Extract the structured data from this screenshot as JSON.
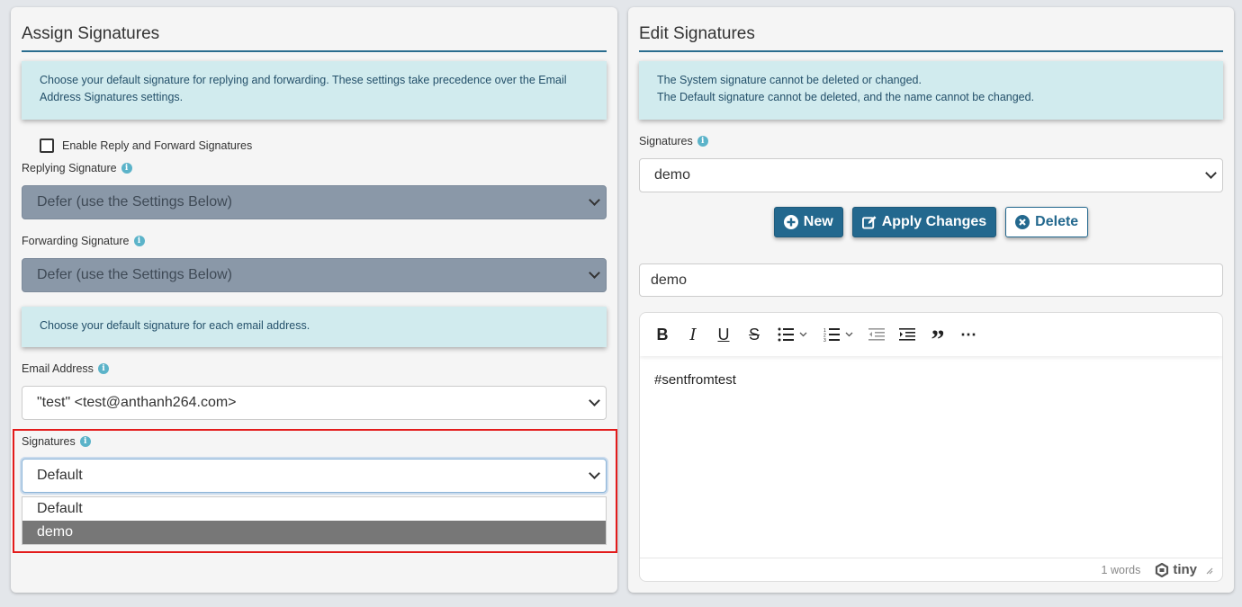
{
  "assign": {
    "title": "Assign Signatures",
    "info1": "Choose your default signature for replying and forwarding. These settings take precedence over the Email Address Signatures settings.",
    "enable_label": "Enable Reply and Forward Signatures",
    "replying_label": "Replying Signature",
    "replying_value": "Defer (use the Settings Below)",
    "forwarding_label": "Forwarding Signature",
    "forwarding_value": "Defer (use the Settings Below)",
    "info2": "Choose your default signature for each email address.",
    "email_label": "Email Address",
    "email_value": "\"test\" <test@anthanh264.com>",
    "signatures_label": "Signatures",
    "signatures_value": "Default",
    "dropdown_options": [
      "Default",
      "demo"
    ],
    "dropdown_highlighted": "demo"
  },
  "edit": {
    "title": "Edit Signatures",
    "info_line1": "The System signature cannot be deleted or changed.",
    "info_line2": "The Default signature cannot be deleted, and the name cannot be changed.",
    "signatures_label": "Signatures",
    "signatures_value": "demo",
    "new_label": "New",
    "apply_label": "Apply Changes",
    "delete_label": "Delete",
    "name_value": "demo",
    "content": "#sentfromtest",
    "word_count": "1 words",
    "brand": "tiny"
  },
  "icons": {
    "info": "info-circle-icon",
    "new": "plus-circle-icon",
    "apply": "edit-icon",
    "delete": "x-circle-icon"
  },
  "colors": {
    "accent": "#23688e",
    "info_bg": "#d1ebee",
    "highlight_border": "#e31b1b",
    "disabled_select": "#8a98a8"
  }
}
